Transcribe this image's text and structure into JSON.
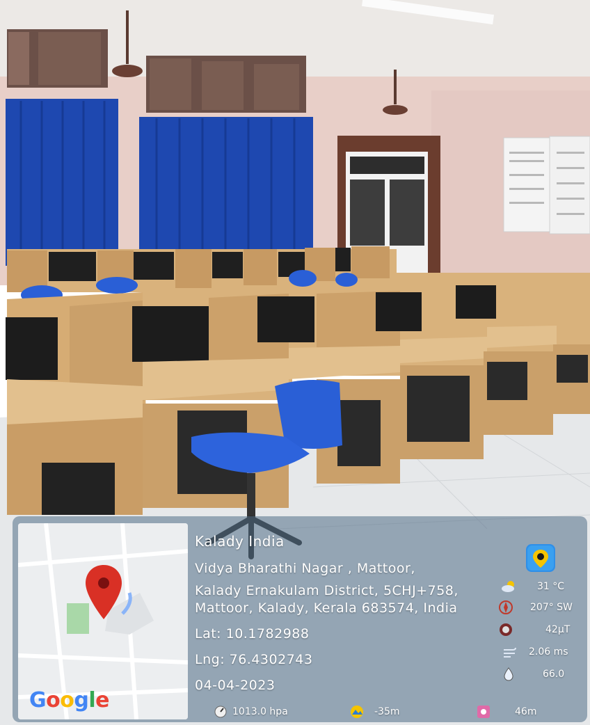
{
  "photo": {
    "subject": "computer lab with study carrels, monitors, and a blue chair",
    "colors": {
      "wall": "#e8cfc8",
      "curtain": "#1e48b0",
      "desk": "#d9b27c",
      "floor": "#e6e8ea",
      "chair": "#2a5fd6"
    }
  },
  "stamp": {
    "map": {
      "logo": [
        "G",
        "o",
        "o",
        "g",
        "l",
        "e"
      ],
      "pin_color": "#d93025"
    },
    "location": {
      "title": "Kalady India",
      "lines": [
        "Vidya Bharathi Nagar , Mattoor,",
        "Kalady Ernakulam District, 5CHJ+758,",
        "Mattoor, Kalady, Kerala 683574, India"
      ],
      "lat": "Lat: 10.1782988",
      "lng": "Lng: 76.4302743",
      "date": "04-04-2023"
    },
    "readings": {
      "temperature": "31 °C",
      "wind_direction": "207° SW",
      "magnetic_field": "42μT",
      "wind_speed": "2.06 ms",
      "humidity": "66.0",
      "pressure": "1013.0 hpa",
      "altitude": "-35m",
      "accuracy": "46m"
    }
  }
}
